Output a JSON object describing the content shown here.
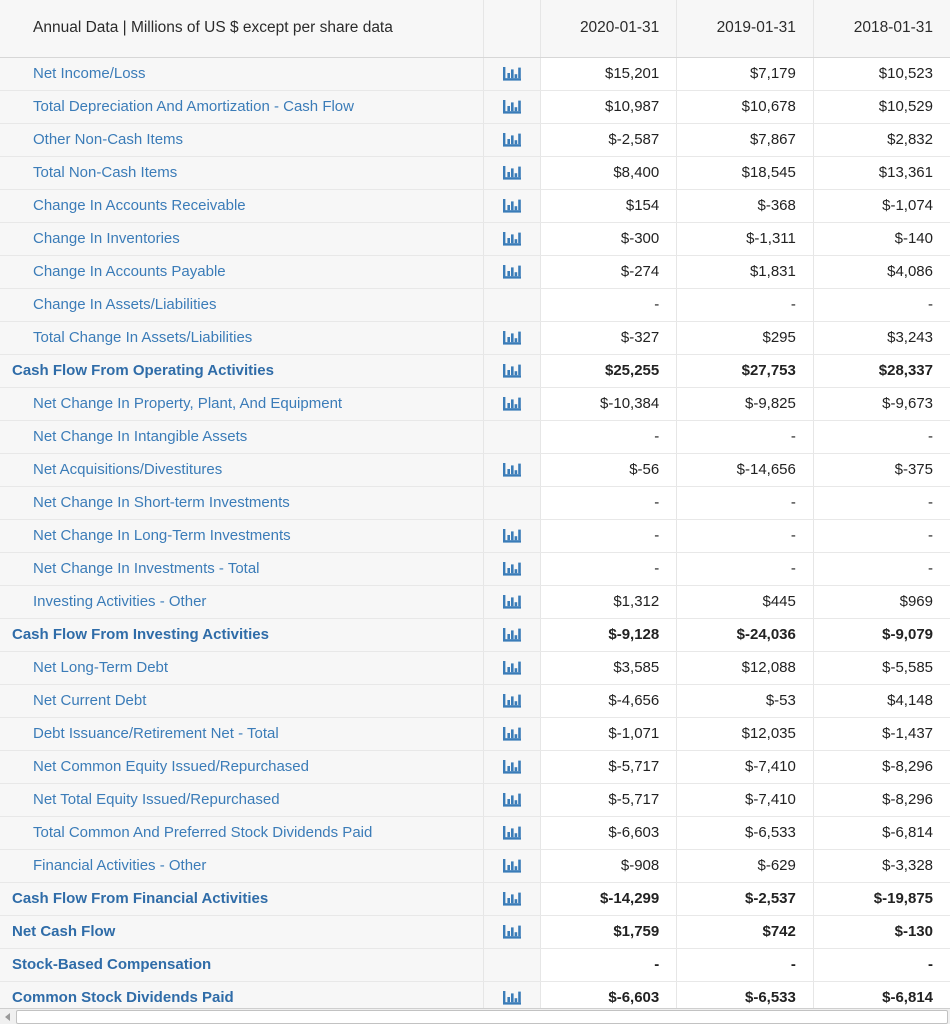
{
  "header": {
    "title": "Annual Data | Millions of US $ except per share data",
    "icon_col": "",
    "periods": [
      "2020-01-31",
      "2019-01-31",
      "2018-01-31"
    ]
  },
  "icons": {
    "chart": "bar-chart-icon"
  },
  "colors": {
    "link_blue": "#3b7cb8",
    "section_blue": "#2f6ca8",
    "icon_blue": "#3a7cb8",
    "label_bg": "#f7f7f7",
    "value_bg": "#ffffff",
    "row_border": "#e8e8e8"
  },
  "scrollbar": {
    "arrow": "scroll-left-arrow"
  },
  "rows": [
    {
      "label": "Net Income/Loss",
      "section": false,
      "chart": true,
      "values": [
        "$15,201",
        "$7,179",
        "$10,523"
      ]
    },
    {
      "label": "Total Depreciation And Amortization - Cash Flow",
      "section": false,
      "chart": true,
      "values": [
        "$10,987",
        "$10,678",
        "$10,529"
      ]
    },
    {
      "label": "Other Non-Cash Items",
      "section": false,
      "chart": true,
      "values": [
        "$-2,587",
        "$7,867",
        "$2,832"
      ]
    },
    {
      "label": "Total Non-Cash Items",
      "section": false,
      "chart": true,
      "values": [
        "$8,400",
        "$18,545",
        "$13,361"
      ]
    },
    {
      "label": "Change In Accounts Receivable",
      "section": false,
      "chart": true,
      "values": [
        "$154",
        "$-368",
        "$-1,074"
      ]
    },
    {
      "label": "Change In Inventories",
      "section": false,
      "chart": true,
      "values": [
        "$-300",
        "$-1,311",
        "$-140"
      ]
    },
    {
      "label": "Change In Accounts Payable",
      "section": false,
      "chart": true,
      "values": [
        "$-274",
        "$1,831",
        "$4,086"
      ]
    },
    {
      "label": "Change In Assets/Liabilities",
      "section": false,
      "chart": false,
      "values": [
        "-",
        "-",
        "-"
      ]
    },
    {
      "label": "Total Change In Assets/Liabilities",
      "section": false,
      "chart": true,
      "values": [
        "$-327",
        "$295",
        "$3,243"
      ]
    },
    {
      "label": "Cash Flow From Operating Activities",
      "section": true,
      "chart": true,
      "values": [
        "$25,255",
        "$27,753",
        "$28,337"
      ]
    },
    {
      "label": "Net Change In Property, Plant, And Equipment",
      "section": false,
      "chart": true,
      "values": [
        "$-10,384",
        "$-9,825",
        "$-9,673"
      ]
    },
    {
      "label": "Net Change In Intangible Assets",
      "section": false,
      "chart": false,
      "values": [
        "-",
        "-",
        "-"
      ]
    },
    {
      "label": "Net Acquisitions/Divestitures",
      "section": false,
      "chart": true,
      "values": [
        "$-56",
        "$-14,656",
        "$-375"
      ]
    },
    {
      "label": "Net Change In Short-term Investments",
      "section": false,
      "chart": false,
      "values": [
        "-",
        "-",
        "-"
      ]
    },
    {
      "label": "Net Change In Long-Term Investments",
      "section": false,
      "chart": true,
      "values": [
        "-",
        "-",
        "-"
      ]
    },
    {
      "label": "Net Change In Investments - Total",
      "section": false,
      "chart": true,
      "values": [
        "-",
        "-",
        "-"
      ]
    },
    {
      "label": "Investing Activities - Other",
      "section": false,
      "chart": true,
      "values": [
        "$1,312",
        "$445",
        "$969"
      ]
    },
    {
      "label": "Cash Flow From Investing Activities",
      "section": true,
      "chart": true,
      "values": [
        "$-9,128",
        "$-24,036",
        "$-9,079"
      ]
    },
    {
      "label": "Net Long-Term Debt",
      "section": false,
      "chart": true,
      "values": [
        "$3,585",
        "$12,088",
        "$-5,585"
      ]
    },
    {
      "label": "Net Current Debt",
      "section": false,
      "chart": true,
      "values": [
        "$-4,656",
        "$-53",
        "$4,148"
      ]
    },
    {
      "label": "Debt Issuance/Retirement Net - Total",
      "section": false,
      "chart": true,
      "values": [
        "$-1,071",
        "$12,035",
        "$-1,437"
      ]
    },
    {
      "label": "Net Common Equity Issued/Repurchased",
      "section": false,
      "chart": true,
      "values": [
        "$-5,717",
        "$-7,410",
        "$-8,296"
      ]
    },
    {
      "label": "Net Total Equity Issued/Repurchased",
      "section": false,
      "chart": true,
      "values": [
        "$-5,717",
        "$-7,410",
        "$-8,296"
      ]
    },
    {
      "label": "Total Common And Preferred Stock Dividends Paid",
      "section": false,
      "chart": true,
      "values": [
        "$-6,603",
        "$-6,533",
        "$-6,814"
      ]
    },
    {
      "label": "Financial Activities - Other",
      "section": false,
      "chart": true,
      "values": [
        "$-908",
        "$-629",
        "$-3,328"
      ]
    },
    {
      "label": "Cash Flow From Financial Activities",
      "section": true,
      "chart": true,
      "values": [
        "$-14,299",
        "$-2,537",
        "$-19,875"
      ]
    },
    {
      "label": "Net Cash Flow",
      "section": true,
      "chart": true,
      "values": [
        "$1,759",
        "$742",
        "$-130"
      ]
    },
    {
      "label": "Stock-Based Compensation",
      "section": true,
      "chart": false,
      "values": [
        "-",
        "-",
        "-"
      ]
    },
    {
      "label": "Common Stock Dividends Paid",
      "section": true,
      "chart": true,
      "values": [
        "$-6,603",
        "$-6,533",
        "$-6,814"
      ]
    }
  ]
}
